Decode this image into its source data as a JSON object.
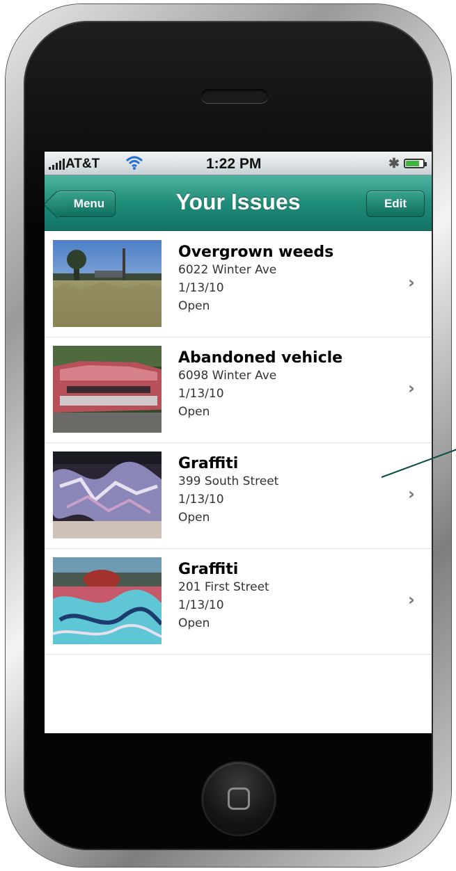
{
  "status_bar": {
    "carrier": "AT&T",
    "time": "1:22 PM",
    "bluetooth_icon": "bluetooth-icon",
    "battery_level": 0.8
  },
  "nav": {
    "title": "Your Issues",
    "back_label": "Menu",
    "edit_label": "Edit"
  },
  "colors": {
    "nav_accent": "#1f8c78",
    "battery": "#3db43d"
  },
  "issues": [
    {
      "title": "Overgrown weeds",
      "address": "6022 Winter Ave",
      "date": "1/13/10",
      "status": "Open",
      "chevron": "›"
    },
    {
      "title": "Abandoned vehicle",
      "address": "6098 Winter Ave",
      "date": "1/13/10",
      "status": "Open",
      "chevron": "›"
    },
    {
      "title": "Graffiti",
      "address": "399 South Street",
      "date": "1/13/10",
      "status": "Open",
      "chevron": "›"
    },
    {
      "title": "Graffiti",
      "address": "201 First Street",
      "date": "1/13/10",
      "status": "Open",
      "chevron": "›"
    }
  ]
}
